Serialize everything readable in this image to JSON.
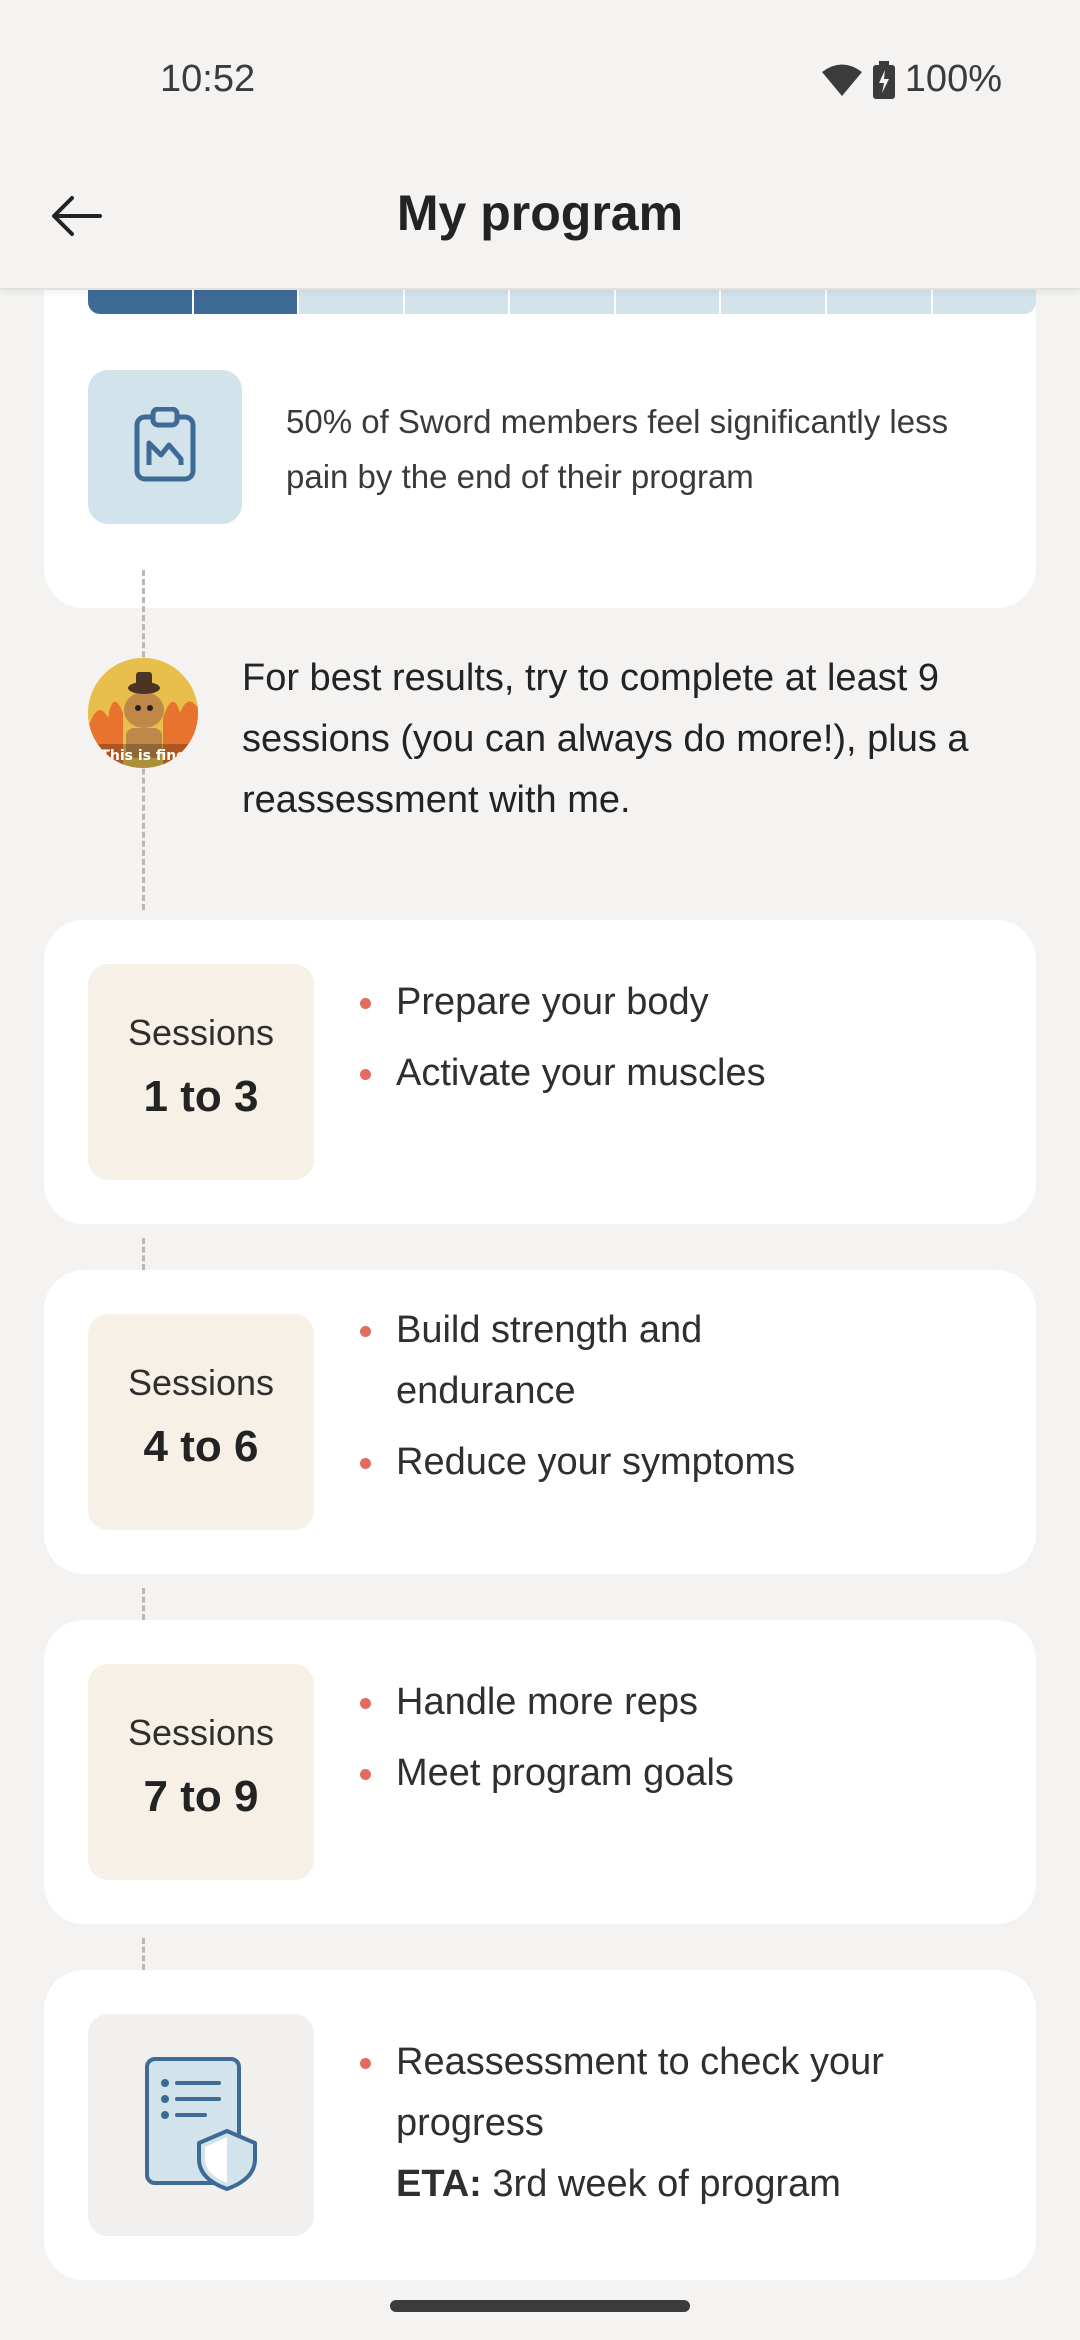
{
  "status_bar": {
    "time": "10:52",
    "battery": "100%"
  },
  "app_bar": {
    "title": "My program"
  },
  "colors": {
    "accent": "#3e6a96",
    "bullet": "#e56b5e",
    "session_bg": "#f6f0e6",
    "stat_icon_bg": "#d3e3ec"
  },
  "progress": {
    "completed_fraction": 0.2222,
    "total_segments": 9,
    "completed_segments": 2
  },
  "stat": {
    "icon": "clipboard-chart-icon",
    "text": "50% of Sword members feel significantly less pain by the end of their program"
  },
  "coach": {
    "avatar_icon": "coach-avatar-icon",
    "avatar_caption": "This is fine",
    "message": "For best results, try to complete at least 9 sessions (you can always do more!), plus a reassessment with me."
  },
  "phases": [
    {
      "label": "Sessions",
      "range": "1 to 3",
      "bullets": [
        "Prepare your body",
        "Activate your muscles"
      ]
    },
    {
      "label": "Sessions",
      "range": "4 to 6",
      "bullets": [
        "Build strength and endurance",
        "Reduce your symptoms"
      ]
    },
    {
      "label": "Sessions",
      "range": "7 to 9",
      "bullets": [
        "Handle more reps",
        "Meet program goals"
      ]
    }
  ],
  "reassessment": {
    "icon": "document-shield-icon",
    "text": "Reassessment to check your progress",
    "eta_label": "ETA:",
    "eta_value": " 3rd week of program"
  }
}
